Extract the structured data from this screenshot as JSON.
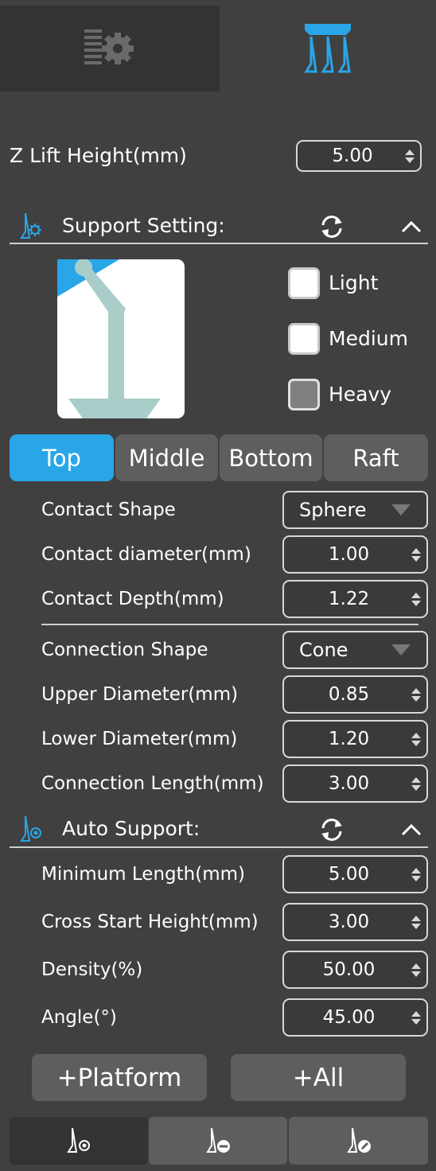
{
  "tabs": [
    {
      "name": "settings-tab-icon"
    },
    {
      "name": "support-tab-icon"
    }
  ],
  "z_lift": {
    "label": "Z Lift Height(mm)",
    "value": "5.00"
  },
  "support_setting": {
    "title": "Support Setting:",
    "presets": [
      {
        "label": "Light",
        "checked": false
      },
      {
        "label": "Medium",
        "checked": false
      },
      {
        "label": "Heavy",
        "checked": true
      }
    ],
    "segments": [
      "Top",
      "Middle",
      "Bottom",
      "Raft"
    ],
    "active_segment": "Top",
    "contact_shape": {
      "label": "Contact Shape",
      "value": "Sphere"
    },
    "contact_diameter": {
      "label": "Contact diameter(mm)",
      "value": "1.00"
    },
    "contact_depth": {
      "label": "Contact Depth(mm)",
      "value": "1.22"
    },
    "connection_shape": {
      "label": "Connection Shape",
      "value": "Cone"
    },
    "upper_diameter": {
      "label": "Upper Diameter(mm)",
      "value": "0.85"
    },
    "lower_diameter": {
      "label": "Lower Diameter(mm)",
      "value": "1.20"
    },
    "connection_length": {
      "label": "Connection Length(mm)",
      "value": "3.00"
    }
  },
  "auto_support": {
    "title": "Auto Support:",
    "minimum_length": {
      "label": "Minimum Length(mm)",
      "value": "5.00"
    },
    "cross_start_height": {
      "label": "Cross Start Height(mm)",
      "value": "3.00"
    },
    "density": {
      "label": "Density(%)",
      "value": "50.00"
    },
    "angle": {
      "label": "Angle(°)",
      "value": "45.00"
    }
  },
  "buttons": {
    "platform": "+Platform",
    "all": "+All"
  },
  "bottom_tools": [
    "add-support-point-icon",
    "remove-support-point-icon",
    "edit-support-point-icon"
  ],
  "colors": {
    "accent": "#29a6e8",
    "background": "#404040",
    "panel": "#333333",
    "preview_support": "#a9cdc9"
  }
}
